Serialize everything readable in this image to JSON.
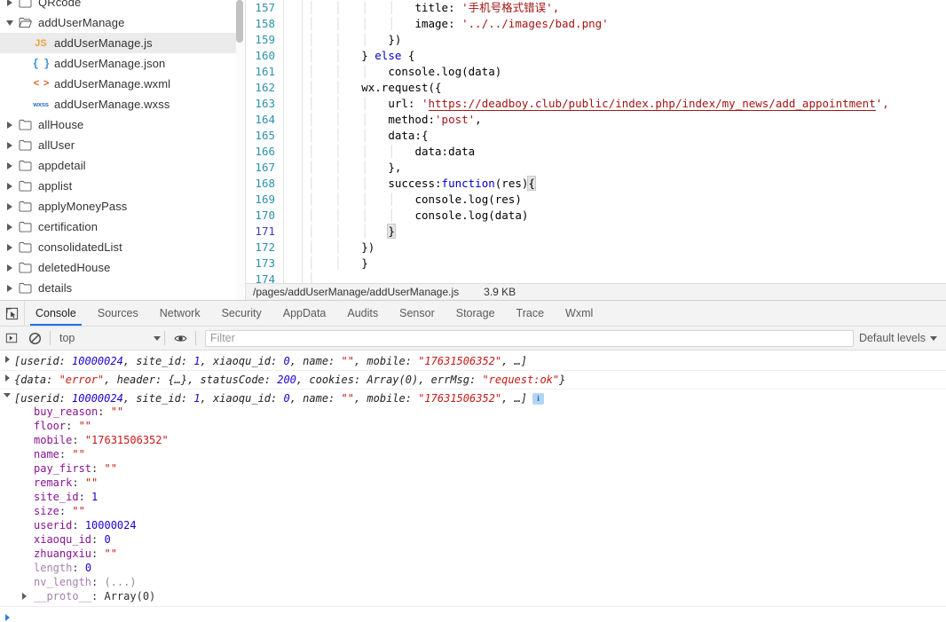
{
  "file_tree": {
    "items": [
      {
        "label": "QRcode",
        "icon": "folder-icon",
        "type": "folder",
        "depth": 1,
        "expanded": false,
        "selected": false,
        "clipped_top": true
      },
      {
        "label": "addUserManage",
        "icon": "folder-open-icon",
        "type": "folder",
        "depth": 1,
        "expanded": true,
        "selected": false
      },
      {
        "label": "addUserManage.js",
        "icon": "js-file-icon",
        "type": "file",
        "depth": 2,
        "selected": true
      },
      {
        "label": "addUserManage.json",
        "icon": "json-file-icon",
        "type": "file",
        "depth": 2,
        "selected": false
      },
      {
        "label": "addUserManage.wxml",
        "icon": "wxml-file-icon",
        "type": "file",
        "depth": 2,
        "selected": false
      },
      {
        "label": "addUserManage.wxss",
        "icon": "wxss-file-icon",
        "type": "file",
        "depth": 2,
        "selected": false
      },
      {
        "label": "allHouse",
        "icon": "folder-icon",
        "type": "folder",
        "depth": 1,
        "expanded": false,
        "selected": false
      },
      {
        "label": "allUser",
        "icon": "folder-icon",
        "type": "folder",
        "depth": 1,
        "expanded": false,
        "selected": false
      },
      {
        "label": "appdetail",
        "icon": "folder-icon",
        "type": "folder",
        "depth": 1,
        "expanded": false,
        "selected": false
      },
      {
        "label": "applist",
        "icon": "folder-icon",
        "type": "folder",
        "depth": 1,
        "expanded": false,
        "selected": false
      },
      {
        "label": "applyMoneyPass",
        "icon": "folder-icon",
        "type": "folder",
        "depth": 1,
        "expanded": false,
        "selected": false
      },
      {
        "label": "certification",
        "icon": "folder-icon",
        "type": "folder",
        "depth": 1,
        "expanded": false,
        "selected": false
      },
      {
        "label": "consolidatedList",
        "icon": "folder-icon",
        "type": "folder",
        "depth": 1,
        "expanded": false,
        "selected": false
      },
      {
        "label": "deletedHouse",
        "icon": "folder-icon",
        "type": "folder",
        "depth": 1,
        "expanded": false,
        "selected": false
      },
      {
        "label": "details",
        "icon": "folder-icon",
        "type": "folder",
        "depth": 1,
        "expanded": false,
        "selected": false
      }
    ]
  },
  "editor": {
    "first_line": 157,
    "current_line": 171,
    "lines": [
      {
        "n": 157,
        "indent": 4,
        "text": "title: '手机号格式错误',"
      },
      {
        "n": 158,
        "indent": 4,
        "text": "image: '../../images/bad.png'"
      },
      {
        "n": 159,
        "indent": 3,
        "text": "})"
      },
      {
        "n": 160,
        "indent": 2,
        "text": "} else {"
      },
      {
        "n": 161,
        "indent": 3,
        "text": "console.log(data)"
      },
      {
        "n": 162,
        "indent": 2,
        "text": "wx.request({"
      },
      {
        "n": 163,
        "indent": 3,
        "text": "url: 'https://deadboy.club/public/index.php/index/my_news/add_appointment',"
      },
      {
        "n": 164,
        "indent": 3,
        "text": "method:'post',"
      },
      {
        "n": 165,
        "indent": 3,
        "text": "data:{"
      },
      {
        "n": 166,
        "indent": 4,
        "text": "data:data"
      },
      {
        "n": 167,
        "indent": 3,
        "text": "},"
      },
      {
        "n": 168,
        "indent": 3,
        "text": "success:function(res){"
      },
      {
        "n": 169,
        "indent": 4,
        "text": "console.log(res)"
      },
      {
        "n": 170,
        "indent": 4,
        "text": "console.log(data)"
      },
      {
        "n": 171,
        "indent": 3,
        "text": "}"
      },
      {
        "n": 172,
        "indent": 2,
        "text": "})"
      },
      {
        "n": 173,
        "indent": 2,
        "text": "}"
      },
      {
        "n": 174,
        "indent": 1,
        "text": ""
      }
    ],
    "url_string": "https://deadboy.club/public/index.php/index/my_news/add_appointment",
    "cjk_string": "手机号格式错误",
    "status": {
      "path": "/pages/addUserManage/addUserManage.js",
      "size": "3.9 KB"
    }
  },
  "devtools": {
    "dock_icon": "dock-inspect-icon",
    "tabs": [
      {
        "label": "Console",
        "active": true
      },
      {
        "label": "Sources",
        "active": false
      },
      {
        "label": "Network",
        "active": false
      },
      {
        "label": "Security",
        "active": false
      },
      {
        "label": "AppData",
        "active": false
      },
      {
        "label": "Audits",
        "active": false
      },
      {
        "label": "Sensor",
        "active": false
      },
      {
        "label": "Storage",
        "active": false
      },
      {
        "label": "Trace",
        "active": false
      },
      {
        "label": "Wxml",
        "active": false
      }
    ],
    "toolbar": {
      "execute_icon": "execute-arrow-icon",
      "clear_icon": "clear-console-icon",
      "context": "top",
      "eye_icon": "live-expression-eye-icon",
      "filter_placeholder": "Filter",
      "filter_value": "",
      "levels_label": "Default levels"
    },
    "console": {
      "messages": [
        {
          "id": "msg-1",
          "expanded": false,
          "segments": [
            {
              "t": "[userid: ",
              "c": "plain"
            },
            {
              "t": "10000024",
              "c": "num"
            },
            {
              "t": ", site_id: ",
              "c": "plain"
            },
            {
              "t": "1",
              "c": "num"
            },
            {
              "t": ", xiaoqu_id: ",
              "c": "plain"
            },
            {
              "t": "0",
              "c": "num"
            },
            {
              "t": ", name: ",
              "c": "plain"
            },
            {
              "t": "\"\"",
              "c": "str"
            },
            {
              "t": ", mobile: ",
              "c": "plain"
            },
            {
              "t": "\"17631506352\"",
              "c": "str"
            },
            {
              "t": ", …]",
              "c": "plain"
            }
          ],
          "badge": null
        },
        {
          "id": "msg-2",
          "expanded": false,
          "segments": [
            {
              "t": "{data: ",
              "c": "plain"
            },
            {
              "t": "\"error\"",
              "c": "str"
            },
            {
              "t": ", header: {…}, statusCode: ",
              "c": "plain"
            },
            {
              "t": "200",
              "c": "num"
            },
            {
              "t": ", cookies: Array(0), errMsg: ",
              "c": "plain"
            },
            {
              "t": "\"request:ok\"",
              "c": "str"
            },
            {
              "t": "}",
              "c": "plain"
            }
          ],
          "badge": null
        },
        {
          "id": "msg-3",
          "expanded": true,
          "segments": [
            {
              "t": "[userid: ",
              "c": "plain"
            },
            {
              "t": "10000024",
              "c": "num"
            },
            {
              "t": ", site_id: ",
              "c": "plain"
            },
            {
              "t": "1",
              "c": "num"
            },
            {
              "t": ", xiaoqu_id: ",
              "c": "plain"
            },
            {
              "t": "0",
              "c": "num"
            },
            {
              "t": ", name: ",
              "c": "plain"
            },
            {
              "t": "\"\"",
              "c": "str"
            },
            {
              "t": ", mobile: ",
              "c": "plain"
            },
            {
              "t": "\"17631506352\"",
              "c": "str"
            },
            {
              "t": ", …]",
              "c": "plain"
            }
          ],
          "badge": "i",
          "properties": [
            {
              "name": "buy_reason",
              "value": "\"\"",
              "vtype": "str",
              "dim": false
            },
            {
              "name": "floor",
              "value": "\"\"",
              "vtype": "str",
              "dim": false
            },
            {
              "name": "mobile",
              "value": "\"17631506352\"",
              "vtype": "str",
              "dim": false
            },
            {
              "name": "name",
              "value": "\"\"",
              "vtype": "str",
              "dim": false
            },
            {
              "name": "pay_first",
              "value": "\"\"",
              "vtype": "str",
              "dim": false
            },
            {
              "name": "remark",
              "value": "\"\"",
              "vtype": "str",
              "dim": false
            },
            {
              "name": "site_id",
              "value": "1",
              "vtype": "num",
              "dim": false
            },
            {
              "name": "size",
              "value": "\"\"",
              "vtype": "str",
              "dim": false
            },
            {
              "name": "userid",
              "value": "10000024",
              "vtype": "num",
              "dim": false
            },
            {
              "name": "xiaoqu_id",
              "value": "0",
              "vtype": "num",
              "dim": false
            },
            {
              "name": "zhuangxiu",
              "value": "\"\"",
              "vtype": "str",
              "dim": false
            },
            {
              "name": "length",
              "value": "0",
              "vtype": "num",
              "dim": true
            },
            {
              "name": "nv_length",
              "value": "(...)",
              "vtype": "dim",
              "dim": true
            },
            {
              "name": "__proto__",
              "value": "Array(0)",
              "vtype": "plain",
              "dim": true,
              "disclosure": true
            }
          ]
        }
      ],
      "prompt_icon": "prompt-arrow-icon"
    }
  },
  "colors": {
    "accent_blue": "#1a73e8",
    "line_number": "#2b91af",
    "string_red": "#a31515",
    "keyword_blue": "#0000c0",
    "console_prop_purple": "#881391",
    "console_string_red": "#c41a16",
    "console_number_blue": "#1c00cf",
    "chrome_gray": "#f3f3f3",
    "selection_gray": "#ebebeb"
  }
}
